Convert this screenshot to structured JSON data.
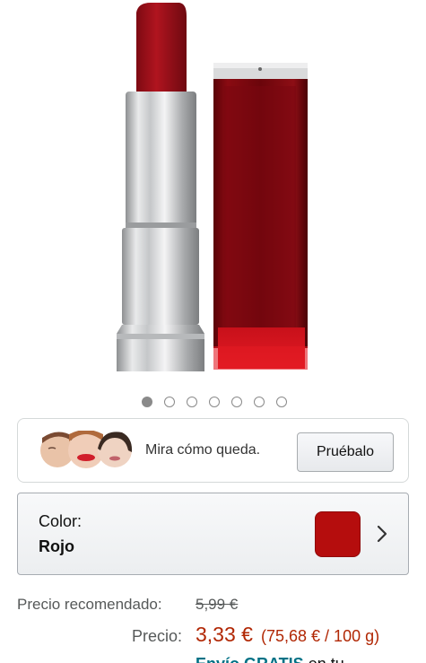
{
  "product": {
    "image_alt": "Barra de labios roja",
    "carousel": {
      "total": 7,
      "active": 0
    }
  },
  "tryon": {
    "text": "Mira cómo queda.",
    "button_label": "Pruébalo"
  },
  "color": {
    "label": "Color:",
    "value": "Rojo",
    "swatch_color": "#b50d0d"
  },
  "price": {
    "recommended_label": "Precio recomendado:",
    "recommended_value": "5,99 €",
    "label": "Precio:",
    "value": "3,33 €",
    "unit_price": "(75,68 € / 100 g)",
    "shipping_highlight": "Envío GRATIS",
    "shipping_rest": " en tu"
  },
  "colors": {
    "price_red": "#b12704",
    "link_teal": "#007185",
    "lipstick_red": "#a3121c"
  }
}
